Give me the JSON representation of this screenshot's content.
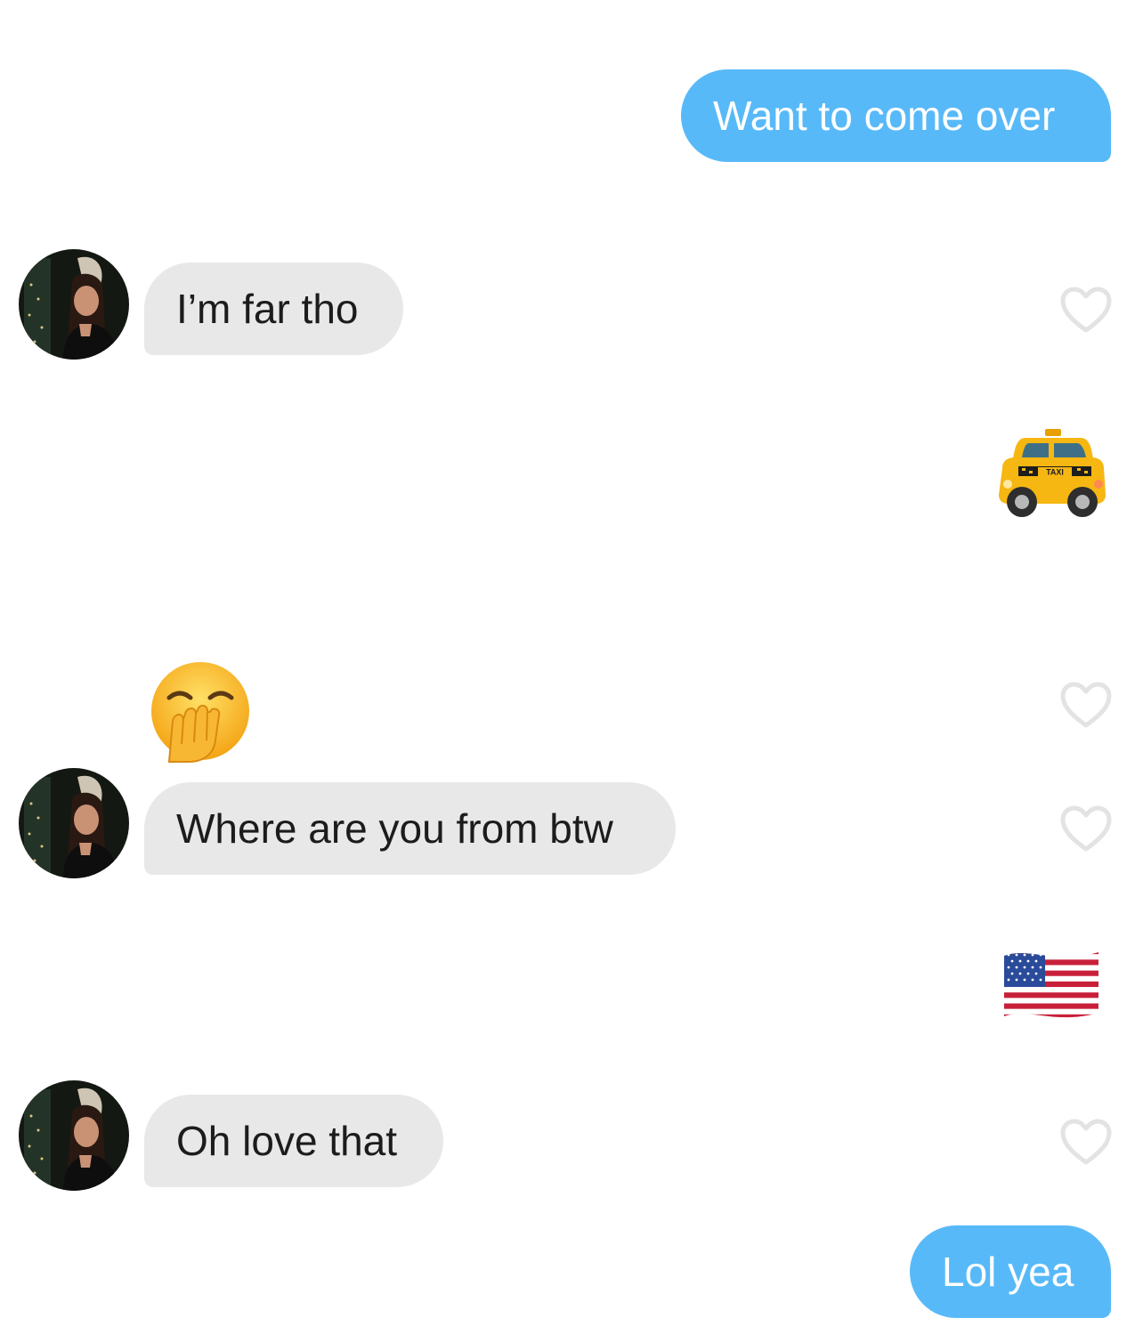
{
  "conversation": {
    "messages": [
      {
        "sender": "me",
        "text": "Want to come over"
      },
      {
        "sender": "them",
        "text": "I’m far tho"
      },
      {
        "sender": "me",
        "emoji": "taxi-emoji"
      },
      {
        "sender": "them",
        "emoji": "yawning-face-emoji"
      },
      {
        "sender": "them",
        "text": "Where are you from btw"
      },
      {
        "sender": "me",
        "emoji": "us-flag-emoji"
      },
      {
        "sender": "them",
        "text": "Oh love that"
      },
      {
        "sender": "me",
        "text": "Lol yea"
      }
    ]
  },
  "colors": {
    "sent_bubble": "#58b9f8",
    "received_bubble": "#e8e8e8",
    "heart_outline": "#e3e3e3",
    "taxi_yellow": "#f6b712"
  }
}
